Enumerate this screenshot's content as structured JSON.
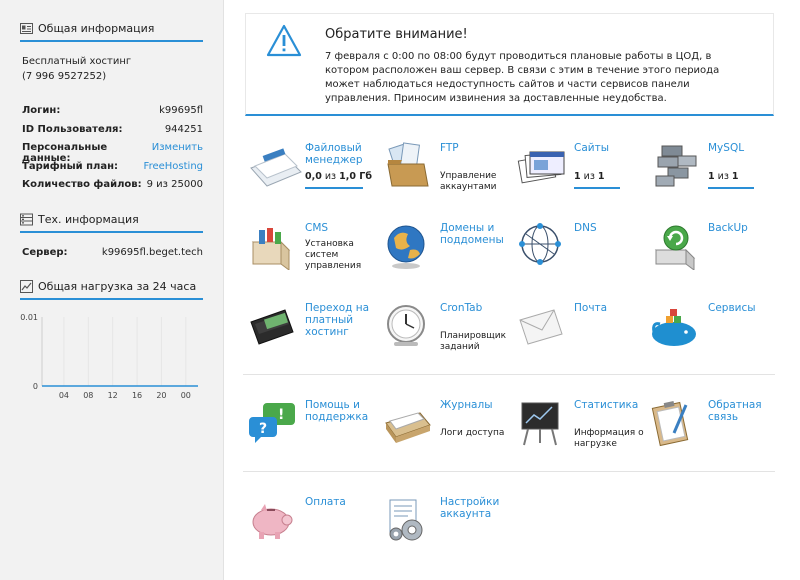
{
  "sidebar": {
    "general": {
      "title": "Общая информация",
      "plan_line": "Бесплатный хостинг",
      "phone": "(7 996 9527252)",
      "fields": [
        {
          "key": "Логин:",
          "value": "k99695fl",
          "link": false
        },
        {
          "key": "ID Пользователя:",
          "value": "944251",
          "link": false
        },
        {
          "key": "Персональные данные:",
          "value": "Изменить",
          "link": true
        },
        {
          "key": "Тарифный план:",
          "value": "FreeHosting",
          "link": true
        },
        {
          "key": "Количество файлов:",
          "value": "9 из 25000",
          "link": false
        }
      ]
    },
    "tech": {
      "title": "Тех. информация",
      "server_key": "Сервер:",
      "server_value": "k99695fl.beget.tech"
    },
    "load": {
      "title": "Общая нагрузка за 24 часа"
    }
  },
  "chart_data": {
    "type": "line",
    "title": "Общая нагрузка за 24 часа",
    "x_ticks": [
      "04",
      "08",
      "12",
      "16",
      "20",
      "00"
    ],
    "y_ticks": [
      "0",
      "0.01"
    ],
    "ylim": [
      0,
      0.01
    ],
    "series": [
      {
        "values": [
          0,
          0,
          0,
          0,
          0,
          0
        ]
      }
    ]
  },
  "notice": {
    "title": "Обратите внимание!",
    "text": "7 февраля с 0:00 по 08:00 будут проводиться плановые работы в ЦОД, в котором расположен ваш сервер. В связи с этим в течение этого периода может наблюдаться недоступность сайтов и части сервисов панели управления. Приносим извинения за доставленные неудобства."
  },
  "tiles": {
    "filemanager": {
      "label": "Файловый менеджер",
      "count": "0,0",
      "of": "из",
      "total": "1,0 Гб"
    },
    "ftp": {
      "label": "FTP",
      "sub": "Управление аккаунтами"
    },
    "sites": {
      "label": "Сайты",
      "count": "1",
      "of": "из",
      "total": "1"
    },
    "mysql": {
      "label": "MySQL",
      "count": "1",
      "of": "из",
      "total": "1"
    },
    "cms": {
      "label": "CMS",
      "sub": "Установка систем управления"
    },
    "domains": {
      "label": "Домены и поддомены"
    },
    "dns": {
      "label": "DNS"
    },
    "backup": {
      "label": "BackUp"
    },
    "paid": {
      "label": "Переход на платный хостинг"
    },
    "crontab": {
      "label": "CronTab",
      "sub": "Планировщик заданий"
    },
    "mail": {
      "label": "Почта"
    },
    "services": {
      "label": "Сервисы"
    },
    "help": {
      "label": "Помощь и поддержка"
    },
    "logs": {
      "label": "Журналы",
      "sub": "Логи доступа"
    },
    "stats": {
      "label": "Статистика",
      "sub": "Информация о нагрузке"
    },
    "feedback": {
      "label": "Обратная связь"
    },
    "payment": {
      "label": "Оплата"
    },
    "settings": {
      "label": "Настройки аккаунта"
    }
  },
  "colors": {
    "accent": "#2a8fd6",
    "sidebar_bg": "#f2f2f2"
  }
}
